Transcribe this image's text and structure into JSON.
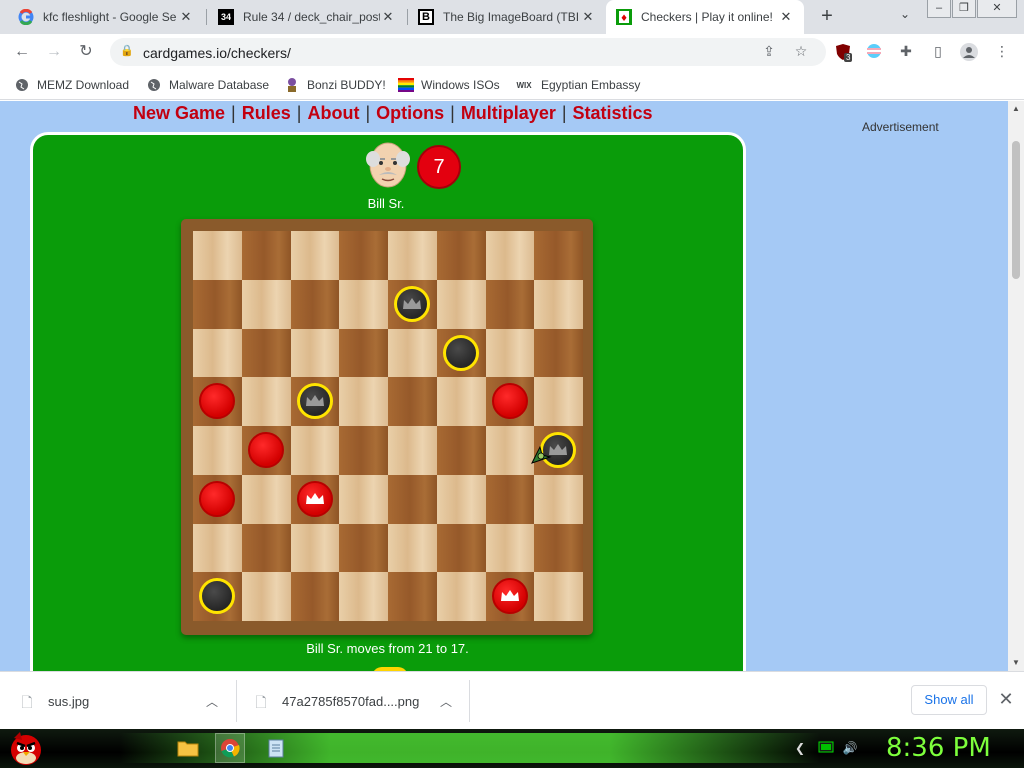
{
  "browser": {
    "tabs": [
      {
        "title": "kfc fleshlight - Google Se",
        "favicon": "google-icon"
      },
      {
        "title": "Rule 34 / deck_chair_post",
        "favicon": "rule34-icon",
        "favicon_text": "34"
      },
      {
        "title": "The Big ImageBoard (TBIB",
        "favicon": "tbib-icon",
        "favicon_text": "B"
      },
      {
        "title": "Checkers | Play it online!",
        "favicon": "checkers-icon"
      }
    ],
    "url": "cardgames.io/checkers/",
    "extension_badge": "3",
    "bookmarks": [
      {
        "label": "MEMZ Download",
        "icon": "globe-icon"
      },
      {
        "label": "Malware Database",
        "icon": "globe-icon"
      },
      {
        "label": "Bonzi BUDDY!",
        "icon": "bonzi-icon"
      },
      {
        "label": "Windows ISOs",
        "icon": "windows-icon"
      },
      {
        "label": "Egyptian Embassy",
        "icon": "wix-icon",
        "icon_text": "WIX"
      }
    ]
  },
  "game": {
    "menu": [
      "New Game",
      "Rules",
      "About",
      "Options",
      "Multiplayer",
      "Statistics"
    ],
    "menu_color": "#c20010",
    "advertisement": "Advertisement",
    "opponent_name": "Bill Sr.",
    "opponent_score": "7",
    "status": "Bill Sr. moves from 21 to 17.",
    "board": [
      [
        "",
        "",
        "",
        "",
        "",
        "",
        "",
        ""
      ],
      [
        "",
        "",
        "",
        "",
        "BK",
        "",
        "",
        ""
      ],
      [
        "",
        "",
        "",
        "",
        "",
        "B",
        "",
        ""
      ],
      [
        "R",
        "",
        "BK",
        "",
        "",
        "",
        "R",
        ""
      ],
      [
        "",
        "R",
        "",
        "",
        "",
        "",
        "",
        "BK"
      ],
      [
        "R",
        "",
        "RK",
        "",
        "",
        "",
        "",
        ""
      ],
      [
        "",
        "",
        "",
        "",
        "",
        "",
        "",
        ""
      ],
      [
        "B",
        "",
        "",
        "",
        "",
        "",
        "RK",
        ""
      ]
    ],
    "board_legend": {
      "R": "red man",
      "RK": "red king",
      "B": "black man",
      "BK": "black king"
    },
    "colors": {
      "felt": "#0a9c0a",
      "red_piece": "#e00000",
      "black_piece": "#2b2b2b",
      "highlight_ring": "#ffe400"
    }
  },
  "downloads": {
    "items": [
      {
        "name": "sus.jpg"
      },
      {
        "name": "47a2785f8570fad....png"
      }
    ],
    "show_all": "Show all"
  },
  "taskbar": {
    "clock": "8:36 PM",
    "pinned": [
      "folder-icon",
      "chrome-icon",
      "notepad-icon"
    ]
  }
}
